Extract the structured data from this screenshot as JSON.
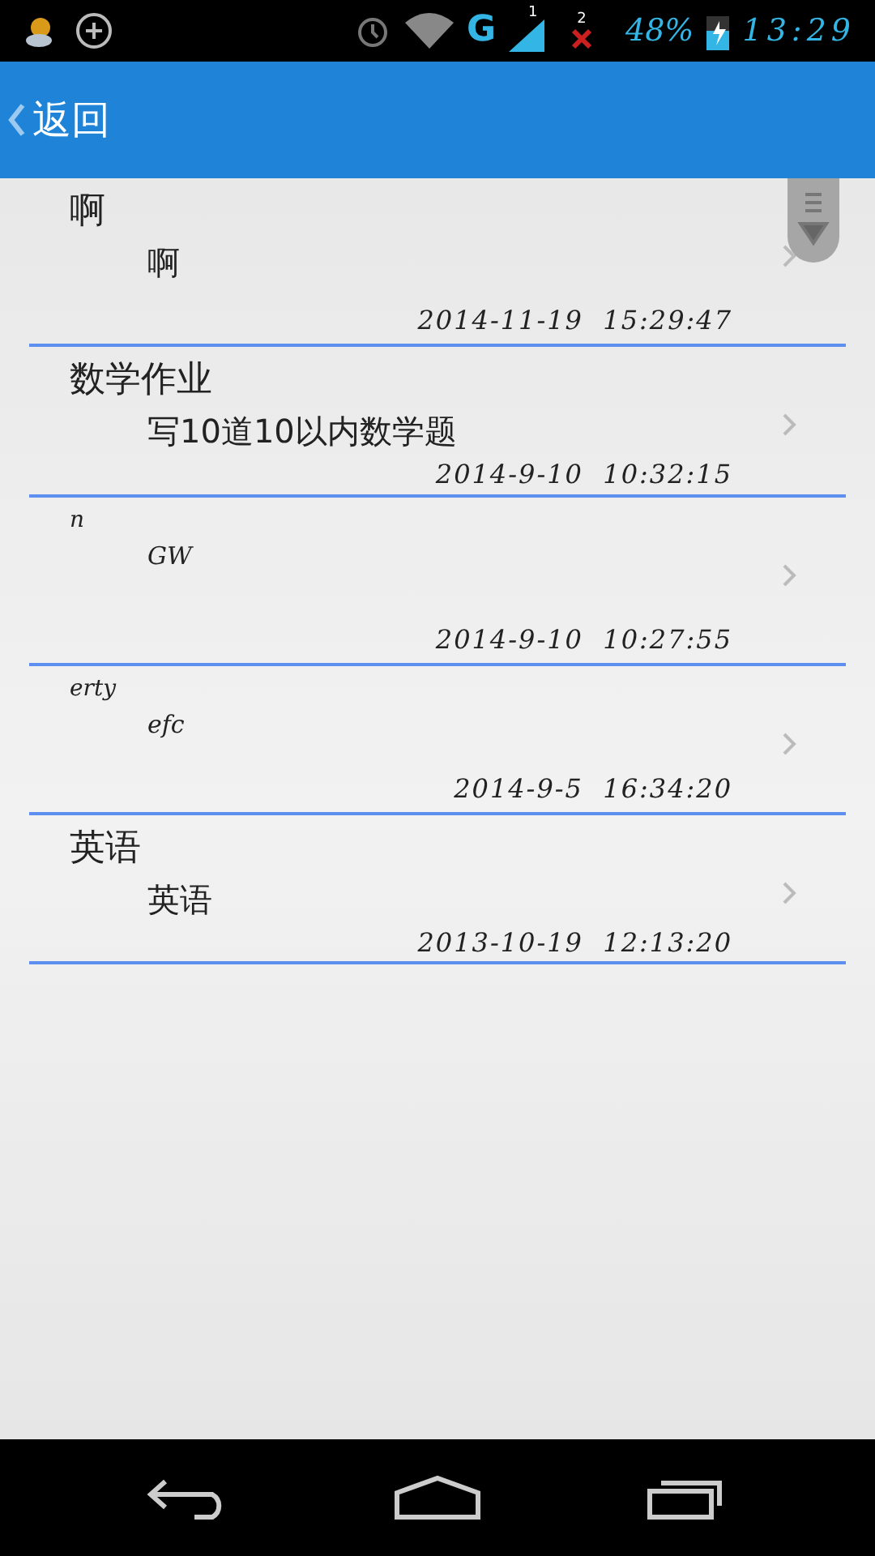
{
  "status_bar": {
    "network": "G",
    "sim_1": "1",
    "sim_2": "2",
    "battery": "48%",
    "time": "13:29"
  },
  "header": {
    "back": "返回"
  },
  "notes": [
    {
      "title": "啊",
      "body": "啊",
      "time": "2014-11-19  15:29:47"
    },
    {
      "title": "数学作业",
      "body": "写10道10以内数学题",
      "time": "2014-9-10  10:32:15"
    },
    {
      "title": "n",
      "body": "GW",
      "time": "2014-9-10  10:27:55"
    },
    {
      "title": "erty",
      "body": "efc",
      "time": "2014-9-5  16:34:20"
    },
    {
      "title": "英语",
      "body": "英语",
      "time": "2013-10-19  12:13:20"
    }
  ]
}
